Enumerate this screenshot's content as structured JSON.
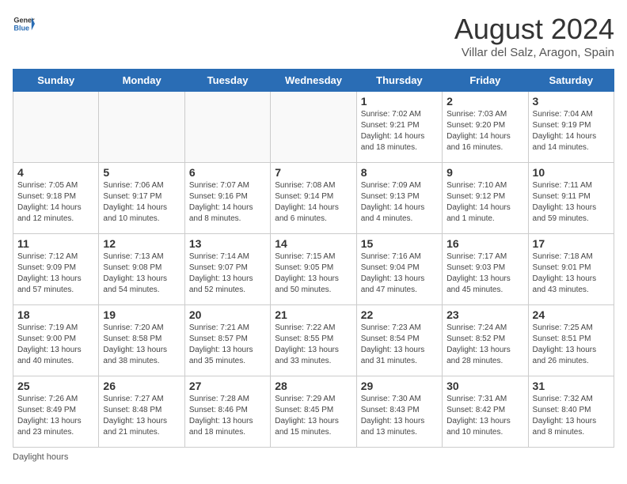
{
  "header": {
    "logo_general": "General",
    "logo_blue": "Blue",
    "title": "August 2024",
    "subtitle": "Villar del Salz, Aragon, Spain"
  },
  "days_of_week": [
    "Sunday",
    "Monday",
    "Tuesday",
    "Wednesday",
    "Thursday",
    "Friday",
    "Saturday"
  ],
  "weeks": [
    [
      {
        "day": "",
        "info": ""
      },
      {
        "day": "",
        "info": ""
      },
      {
        "day": "",
        "info": ""
      },
      {
        "day": "",
        "info": ""
      },
      {
        "day": "1",
        "info": "Sunrise: 7:02 AM\nSunset: 9:21 PM\nDaylight: 14 hours\nand 18 minutes."
      },
      {
        "day": "2",
        "info": "Sunrise: 7:03 AM\nSunset: 9:20 PM\nDaylight: 14 hours\nand 16 minutes."
      },
      {
        "day": "3",
        "info": "Sunrise: 7:04 AM\nSunset: 9:19 PM\nDaylight: 14 hours\nand 14 minutes."
      }
    ],
    [
      {
        "day": "4",
        "info": "Sunrise: 7:05 AM\nSunset: 9:18 PM\nDaylight: 14 hours\nand 12 minutes."
      },
      {
        "day": "5",
        "info": "Sunrise: 7:06 AM\nSunset: 9:17 PM\nDaylight: 14 hours\nand 10 minutes."
      },
      {
        "day": "6",
        "info": "Sunrise: 7:07 AM\nSunset: 9:16 PM\nDaylight: 14 hours\nand 8 minutes."
      },
      {
        "day": "7",
        "info": "Sunrise: 7:08 AM\nSunset: 9:14 PM\nDaylight: 14 hours\nand 6 minutes."
      },
      {
        "day": "8",
        "info": "Sunrise: 7:09 AM\nSunset: 9:13 PM\nDaylight: 14 hours\nand 4 minutes."
      },
      {
        "day": "9",
        "info": "Sunrise: 7:10 AM\nSunset: 9:12 PM\nDaylight: 14 hours\nand 1 minute."
      },
      {
        "day": "10",
        "info": "Sunrise: 7:11 AM\nSunset: 9:11 PM\nDaylight: 13 hours\nand 59 minutes."
      }
    ],
    [
      {
        "day": "11",
        "info": "Sunrise: 7:12 AM\nSunset: 9:09 PM\nDaylight: 13 hours\nand 57 minutes."
      },
      {
        "day": "12",
        "info": "Sunrise: 7:13 AM\nSunset: 9:08 PM\nDaylight: 13 hours\nand 54 minutes."
      },
      {
        "day": "13",
        "info": "Sunrise: 7:14 AM\nSunset: 9:07 PM\nDaylight: 13 hours\nand 52 minutes."
      },
      {
        "day": "14",
        "info": "Sunrise: 7:15 AM\nSunset: 9:05 PM\nDaylight: 13 hours\nand 50 minutes."
      },
      {
        "day": "15",
        "info": "Sunrise: 7:16 AM\nSunset: 9:04 PM\nDaylight: 13 hours\nand 47 minutes."
      },
      {
        "day": "16",
        "info": "Sunrise: 7:17 AM\nSunset: 9:03 PM\nDaylight: 13 hours\nand 45 minutes."
      },
      {
        "day": "17",
        "info": "Sunrise: 7:18 AM\nSunset: 9:01 PM\nDaylight: 13 hours\nand 43 minutes."
      }
    ],
    [
      {
        "day": "18",
        "info": "Sunrise: 7:19 AM\nSunset: 9:00 PM\nDaylight: 13 hours\nand 40 minutes."
      },
      {
        "day": "19",
        "info": "Sunrise: 7:20 AM\nSunset: 8:58 PM\nDaylight: 13 hours\nand 38 minutes."
      },
      {
        "day": "20",
        "info": "Sunrise: 7:21 AM\nSunset: 8:57 PM\nDaylight: 13 hours\nand 35 minutes."
      },
      {
        "day": "21",
        "info": "Sunrise: 7:22 AM\nSunset: 8:55 PM\nDaylight: 13 hours\nand 33 minutes."
      },
      {
        "day": "22",
        "info": "Sunrise: 7:23 AM\nSunset: 8:54 PM\nDaylight: 13 hours\nand 31 minutes."
      },
      {
        "day": "23",
        "info": "Sunrise: 7:24 AM\nSunset: 8:52 PM\nDaylight: 13 hours\nand 28 minutes."
      },
      {
        "day": "24",
        "info": "Sunrise: 7:25 AM\nSunset: 8:51 PM\nDaylight: 13 hours\nand 26 minutes."
      }
    ],
    [
      {
        "day": "25",
        "info": "Sunrise: 7:26 AM\nSunset: 8:49 PM\nDaylight: 13 hours\nand 23 minutes."
      },
      {
        "day": "26",
        "info": "Sunrise: 7:27 AM\nSunset: 8:48 PM\nDaylight: 13 hours\nand 21 minutes."
      },
      {
        "day": "27",
        "info": "Sunrise: 7:28 AM\nSunset: 8:46 PM\nDaylight: 13 hours\nand 18 minutes."
      },
      {
        "day": "28",
        "info": "Sunrise: 7:29 AM\nSunset: 8:45 PM\nDaylight: 13 hours\nand 15 minutes."
      },
      {
        "day": "29",
        "info": "Sunrise: 7:30 AM\nSunset: 8:43 PM\nDaylight: 13 hours\nand 13 minutes."
      },
      {
        "day": "30",
        "info": "Sunrise: 7:31 AM\nSunset: 8:42 PM\nDaylight: 13 hours\nand 10 minutes."
      },
      {
        "day": "31",
        "info": "Sunrise: 7:32 AM\nSunset: 8:40 PM\nDaylight: 13 hours\nand 8 minutes."
      }
    ]
  ],
  "footer": {
    "daylight_label": "Daylight hours"
  }
}
